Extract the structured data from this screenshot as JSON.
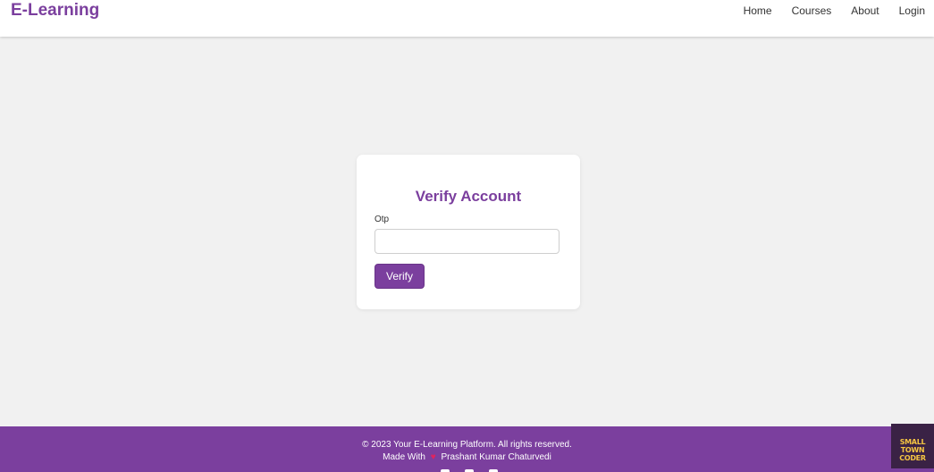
{
  "navbar": {
    "logo": "E-Learning",
    "links": [
      "Home",
      "Courses",
      "About",
      "Login"
    ]
  },
  "card": {
    "title": "Verify Account",
    "otp_label": "Otp",
    "otp_value": "",
    "verify_label": "Verify"
  },
  "footer": {
    "copyright": "© 2023 Your E-Learning Platform. All rights reserved.",
    "made_with": "Made With",
    "heart": "♥",
    "author": "Prashant Kumar Chaturvedi",
    "badge_line1": "SMALL TOWN",
    "badge_line2": "CODER"
  },
  "colors": {
    "brand": "#7b3f9e",
    "background": "#f1f1f1"
  }
}
